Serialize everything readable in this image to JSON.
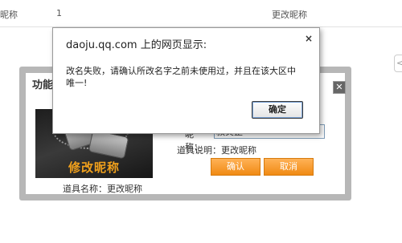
{
  "background": {
    "row_col1": "昵称",
    "row_col2": "1",
    "row_col3": "更改昵称",
    "side_arrow": "<"
  },
  "item_dialog": {
    "title": "功能",
    "close": "✕",
    "image_caption": "修改昵称",
    "item_name": "道具名称：更改昵称",
    "nick_label": "昵称：",
    "nick_value": "叔炎正",
    "description": "道具说明：更改昵称",
    "confirm_label": "确认",
    "cancel_label": "取消"
  },
  "alert": {
    "title": "daoju.qq.com 上的网页显示:",
    "close": "×",
    "message": "改名失败，请确认所改名字之前未使用过，并且在该大区中唯一!",
    "ok_label": "确定"
  },
  "colors": {
    "accent_orange": "#f08a13",
    "caption_orange": "#f0a01c",
    "dialog_border": "#b7b7b7"
  }
}
